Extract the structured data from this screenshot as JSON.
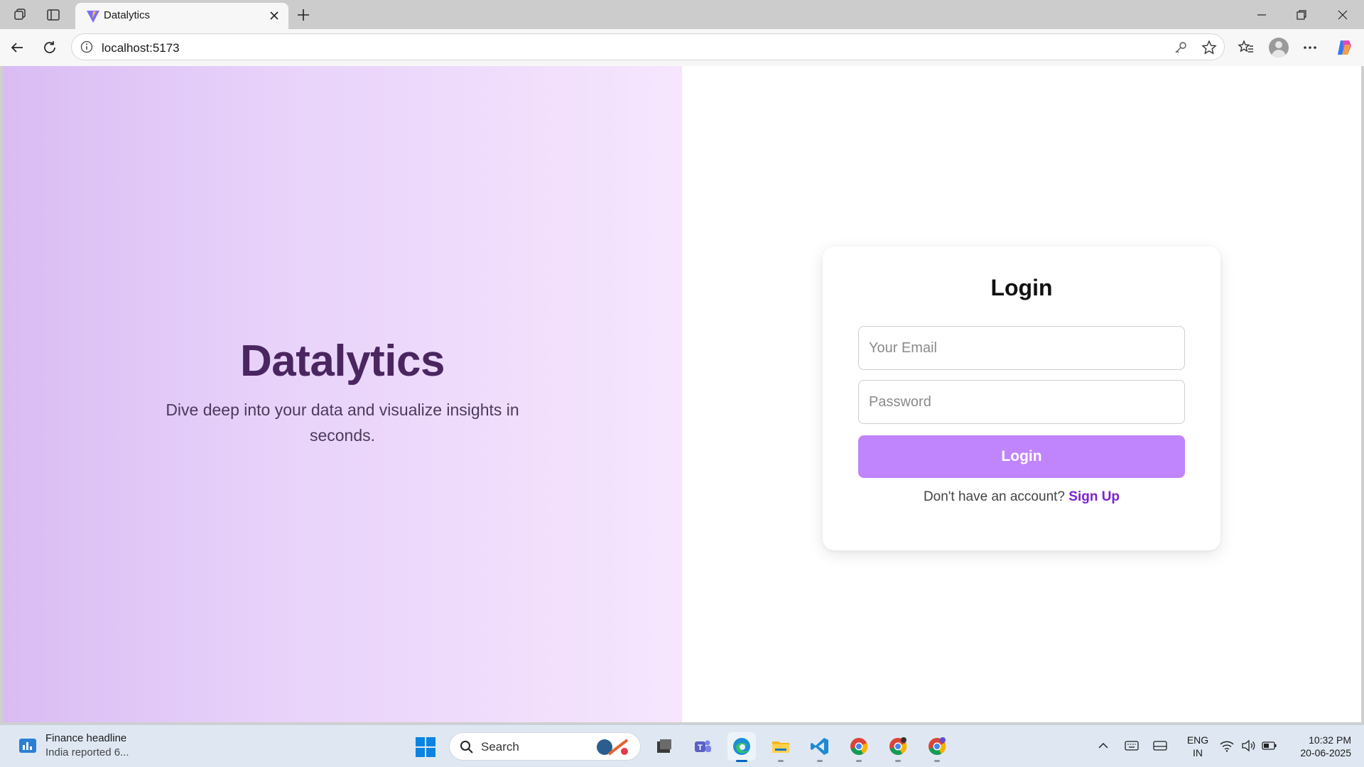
{
  "browser": {
    "tab": {
      "title": "Datalytics",
      "favicon": "vite-logo-icon"
    },
    "address": {
      "url": "localhost:5173"
    },
    "icons": {
      "workspaces": "workspaces-icon",
      "tab_actions": "tab-actions-icon",
      "new_tab": "plus-icon",
      "back": "back-arrow-icon",
      "refresh": "refresh-icon",
      "site_info": "info-icon",
      "password": "key-icon",
      "favorite": "star-icon",
      "favorites": "favorites-icon",
      "profile": "profile-avatar-icon",
      "menu": "more-icon",
      "copilot": "copilot-icon"
    }
  },
  "page": {
    "hero": {
      "title": "Datalytics",
      "subtitle": "Dive deep into your data and visualize insights in seconds."
    },
    "login": {
      "title": "Login",
      "email_placeholder": "Your Email",
      "email_value": "",
      "password_placeholder": "Password",
      "password_value": "",
      "submit_label": "Login",
      "signup_prompt": "Don't have an account?",
      "signup_link": "Sign Up"
    },
    "colors": {
      "hero_gradient_start": "#d9bcf3",
      "hero_gradient_end": "#f6e6fd",
      "hero_title": "#4a2660",
      "button": "#c084fc",
      "link": "#7e22ce"
    }
  },
  "taskbar": {
    "widget": {
      "title": "Finance headline",
      "subtitle": "India reported 6..."
    },
    "search_label": "Search",
    "apps": [
      "task-view-icon",
      "teams-icon",
      "edge-icon",
      "file-explorer-icon",
      "vscode-icon",
      "chrome-icon",
      "chrome-icon",
      "chrome-icon"
    ],
    "language": {
      "line1": "ENG",
      "line2": "IN"
    },
    "clock": {
      "time": "10:32 PM",
      "date": "20-06-2025"
    }
  }
}
